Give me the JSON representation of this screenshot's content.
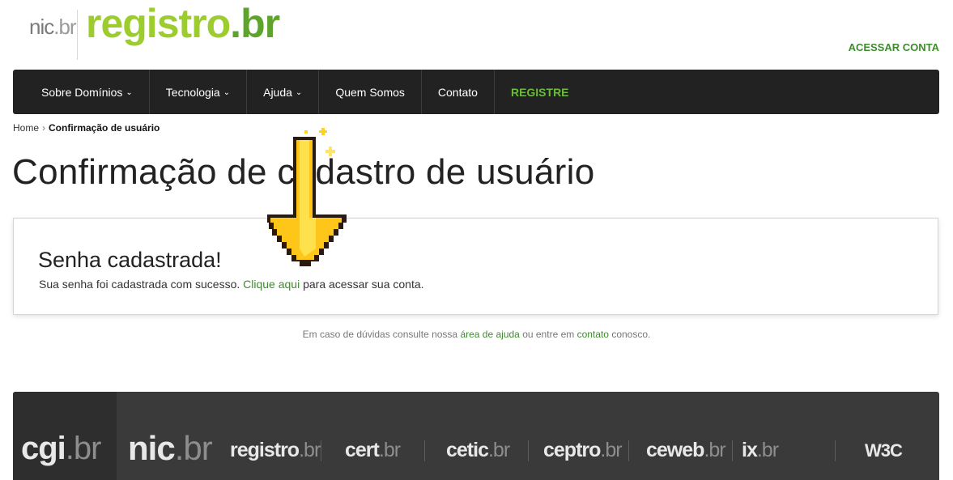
{
  "header": {
    "logo_nic": "nic",
    "logo_nic_dot": ".br",
    "logo_registro": "registro",
    "logo_registro_br": ".br",
    "account_link": "ACESSAR CONTA"
  },
  "nav": {
    "items": [
      {
        "label": "Sobre Domínios",
        "has_dropdown": true
      },
      {
        "label": "Tecnologia",
        "has_dropdown": true
      },
      {
        "label": "Ajuda",
        "has_dropdown": true
      },
      {
        "label": "Quem Somos",
        "has_dropdown": false
      },
      {
        "label": "Contato",
        "has_dropdown": false
      },
      {
        "label": "REGISTRE",
        "has_dropdown": false
      }
    ],
    "chevron": "⌄"
  },
  "breadcrumb": {
    "home": "Home",
    "separator": "›",
    "current": "Confirmação de usuário"
  },
  "page_title": "Confirmação de cadastro de usuário",
  "card": {
    "title": "Senha cadastrada!",
    "text_before": "Sua senha foi cadastrada com sucesso.",
    "link": "Clique aqui",
    "text_after": "para acessar sua conta."
  },
  "help": {
    "before": "Em caso de dúvidas consulte nossa",
    "link1": "área de ajuda",
    "middle": "ou entre em",
    "link2": "contato",
    "after": "conosco."
  },
  "footer": {
    "logos": [
      {
        "name": "cgi",
        "dot": ".br"
      },
      {
        "name": "nic",
        "dot": ".br"
      },
      {
        "name": "registro",
        "dot": ".br"
      },
      {
        "name": "cert",
        "dot": ".br"
      },
      {
        "name": "cetic",
        "dot": ".br"
      },
      {
        "name": "ceptro",
        "dot": ".br"
      },
      {
        "name": "ceweb",
        "dot": ".br"
      },
      {
        "name": "ix",
        "dot": ".br"
      },
      {
        "name": "W3C",
        "dot": ""
      }
    ]
  },
  "colors": {
    "brand_green": "#9ccc2e",
    "link_green": "#3d8d2c",
    "nav_bg": "#222222",
    "footer_bg": "#3a3a3a",
    "arrow_yellow": "#ffd21f"
  }
}
